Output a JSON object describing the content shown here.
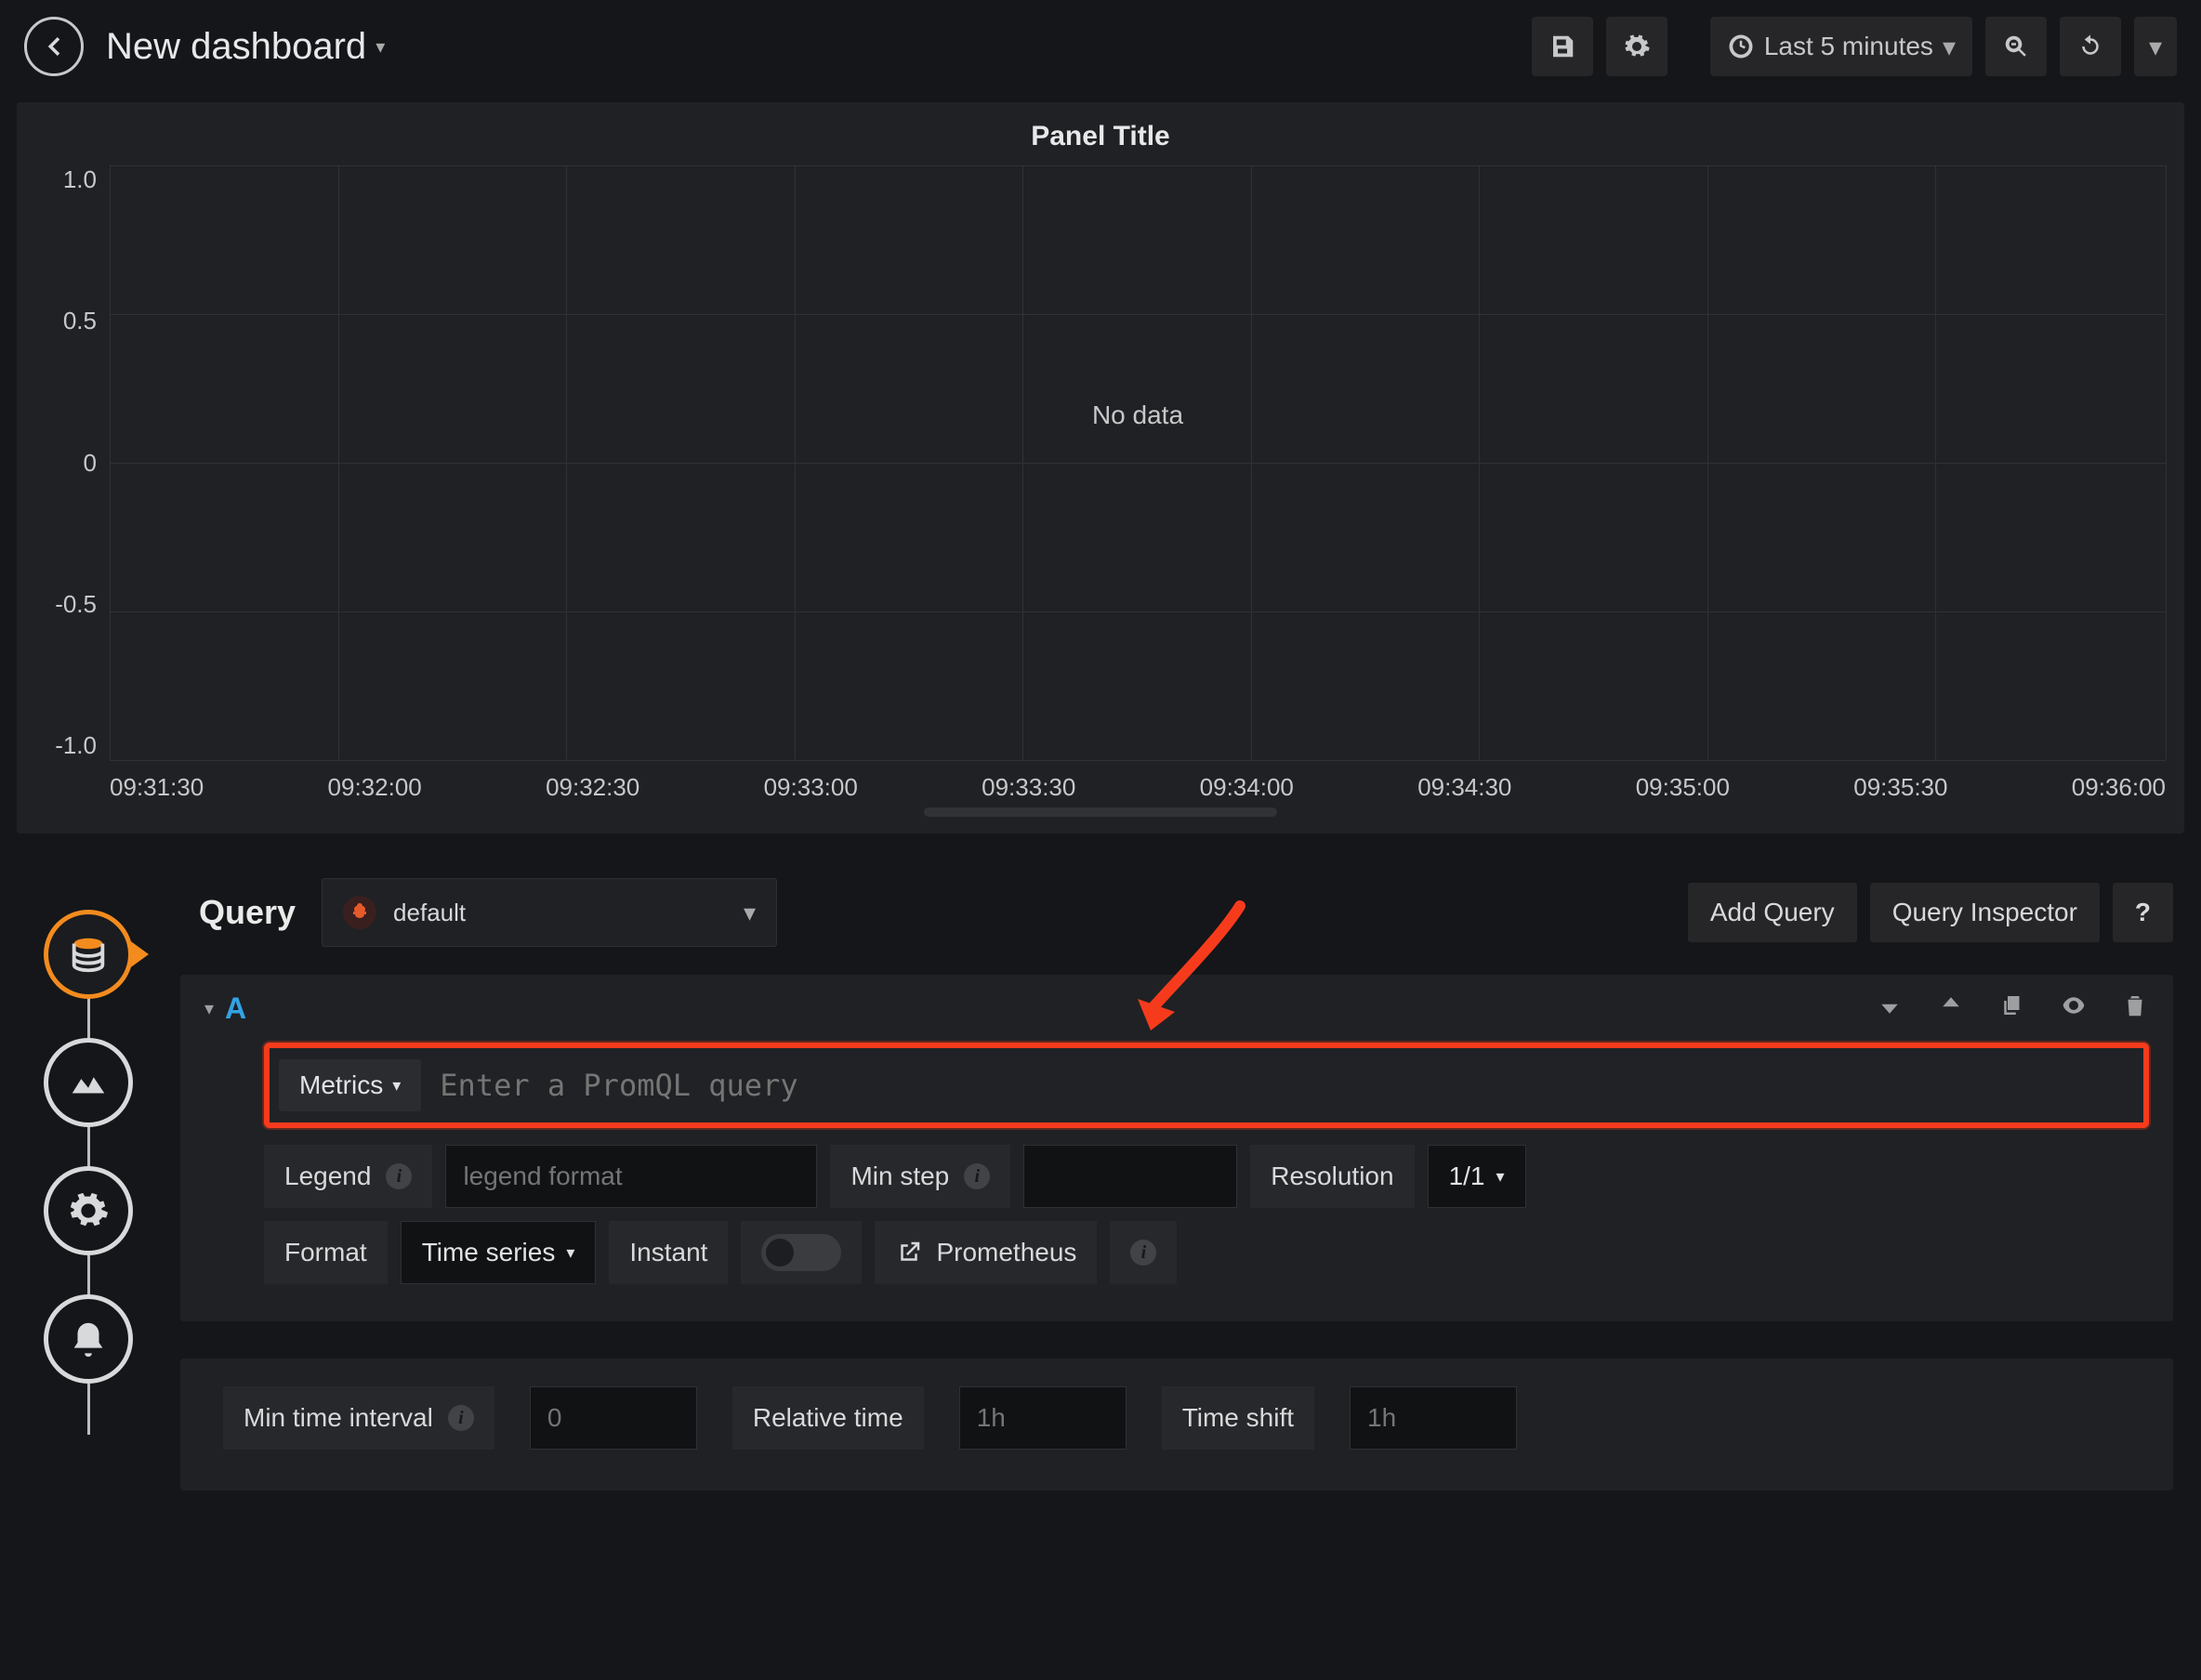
{
  "header": {
    "title": "New dashboard",
    "time_range": "Last 5 minutes"
  },
  "panel": {
    "title": "Panel Title",
    "no_data": "No data"
  },
  "chart_data": {
    "type": "line",
    "title": "Panel Title",
    "series": [],
    "x_ticks": [
      "09:31:30",
      "09:32:00",
      "09:32:30",
      "09:33:00",
      "09:33:30",
      "09:34:00",
      "09:34:30",
      "09:35:00",
      "09:35:30",
      "09:36:00"
    ],
    "y_ticks": [
      "1.0",
      "0.5",
      "0",
      "-0.5",
      "-1.0"
    ],
    "xlabel": "",
    "ylabel": "",
    "ylim": [
      -1.0,
      1.0
    ],
    "message": "No data"
  },
  "query_header": {
    "title": "Query",
    "datasource": "default",
    "add_query": "Add Query",
    "inspector": "Query Inspector",
    "help": "?"
  },
  "query": {
    "id": "A",
    "metrics_btn": "Metrics",
    "promql_placeholder": "Enter a PromQL query",
    "legend_label": "Legend",
    "legend_placeholder": "legend format",
    "minstep_label": "Min step",
    "resolution_label": "Resolution",
    "resolution_value": "1/1",
    "format_label": "Format",
    "format_value": "Time series",
    "instant_label": "Instant",
    "prom_link": "Prometheus"
  },
  "options": {
    "min_interval_label": "Min time interval",
    "min_interval_placeholder": "0",
    "relative_label": "Relative time",
    "relative_placeholder": "1h",
    "shift_label": "Time shift",
    "shift_placeholder": "1h"
  }
}
